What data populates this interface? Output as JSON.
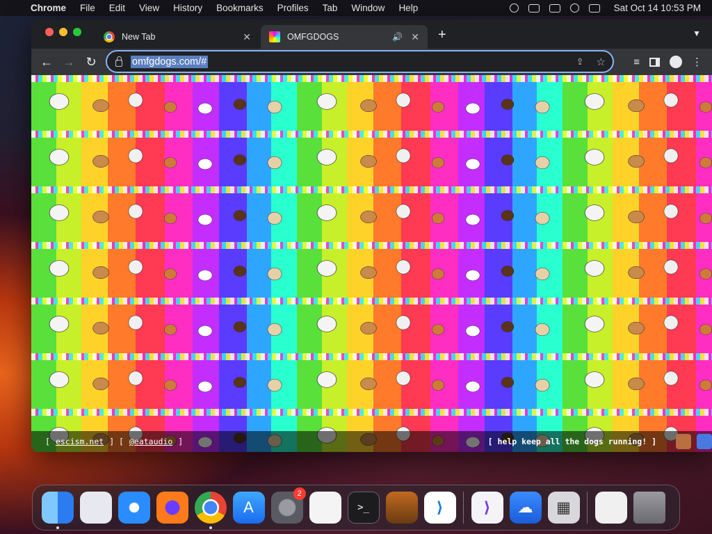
{
  "menubar": {
    "app_name": "Chrome",
    "items": [
      "File",
      "Edit",
      "View",
      "History",
      "Bookmarks",
      "Profiles",
      "Tab",
      "Window",
      "Help"
    ],
    "clock": "Sat Oct 14  10:53 PM"
  },
  "browser": {
    "tabs": [
      {
        "title": "New Tab",
        "icon": "chrome-icon",
        "active": false
      },
      {
        "title": "OMFGDOGS",
        "icon": "omfgdogs-favicon",
        "active": true,
        "playing_audio": true
      }
    ],
    "address": "omfgdogs.com/#"
  },
  "page": {
    "footer_left_open": "[",
    "footer_link_1": "escism.net",
    "footer_mid": "] [",
    "footer_link_2": "@eataudio",
    "footer_left_close": "]",
    "footer_right": "[ help keep all the dogs running! ]"
  },
  "dock": {
    "items": [
      "finder-icon",
      "launchpad-icon",
      "safari-icon",
      "firefox-icon",
      "chrome-icon",
      "app-store-icon",
      "system-settings-icon",
      "textedit-icon",
      "terminal-icon",
      "garageband-icon",
      "vscode-icon",
      "visual-studio-icon",
      "weather-icon",
      "calculator-icon",
      "preview-icon",
      "trash-icon"
    ],
    "settings_badge": "2"
  }
}
